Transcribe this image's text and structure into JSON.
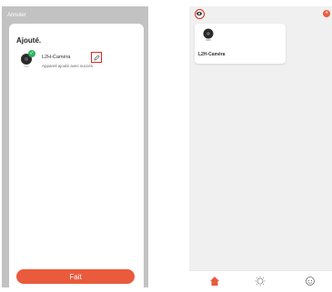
{
  "left": {
    "cancel_label": "Annuler",
    "title": "Ajouté.",
    "device": {
      "name": "L2H-Caméra",
      "status": "Appareil ajouté avec succès",
      "badge": "✓"
    },
    "done_label": "Fait"
  },
  "right": {
    "add_label": "+",
    "device_card_label": "L2H-Caméra",
    "tabs": [
      {
        "icon": "home-icon"
      },
      {
        "icon": "scene-icon"
      },
      {
        "icon": "profile-icon"
      }
    ]
  },
  "colors": {
    "accent": "#ea5a3c",
    "success": "#2fb35f",
    "highlight": "#e02a20",
    "dim": "#c2c2c2"
  }
}
